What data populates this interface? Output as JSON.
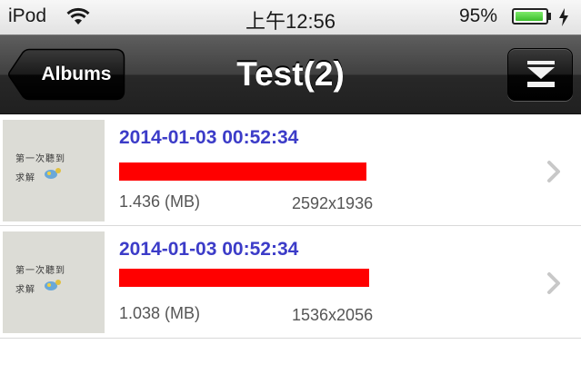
{
  "status_bar": {
    "carrier": "iPod",
    "time": "上午12:56",
    "battery_percent_label": "95%",
    "battery_level": 0.95,
    "battery_color": "#4cd137"
  },
  "nav_bar": {
    "back_label": "Albums",
    "title": "Test(2)",
    "action_icon": "download-icon"
  },
  "items": [
    {
      "date": "2014-01-03 00:52:34",
      "size": "1.436 (MB)",
      "dimensions": "2592x1936",
      "thumbnail_caption_line1": "第一次聽到",
      "thumbnail_caption_line2": "求解",
      "detail_redacted": true
    },
    {
      "date": "2014-01-03 00:52:34",
      "size": "1.038 (MB)",
      "dimensions": "1536x2056",
      "thumbnail_caption_line1": "第一次聽到",
      "thumbnail_caption_line2": "求解",
      "detail_redacted": true
    }
  ],
  "colors": {
    "date_text": "#3c3cc8",
    "redaction": "#ff0000",
    "nav_bar": "#333333"
  }
}
